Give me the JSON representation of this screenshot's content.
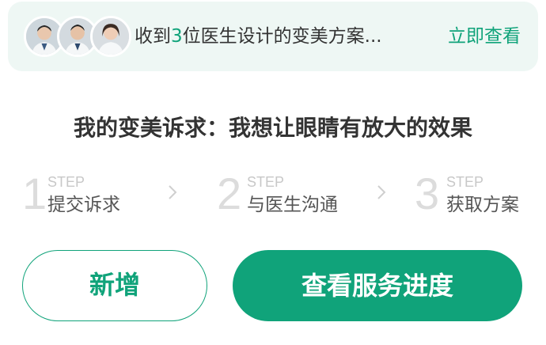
{
  "banner": {
    "text_prefix": "收到",
    "doctor_count": "3",
    "text_suffix": "位医生设计的变美方案...",
    "link_label": "立即查看",
    "avatars": [
      "doctor-avatar-1",
      "doctor-avatar-2",
      "doctor-avatar-3"
    ]
  },
  "request": {
    "title": "我的变美诉求：我想让眼睛有放大的效果"
  },
  "steps": [
    {
      "number": "1",
      "step_text": "STEP",
      "label": "提交诉求"
    },
    {
      "number": "2",
      "step_text": "STEP",
      "label": "与医生沟通"
    },
    {
      "number": "3",
      "step_text": "STEP",
      "label": "获取方案"
    }
  ],
  "actions": {
    "add_label": "新增",
    "progress_label": "查看服务进度"
  },
  "colors": {
    "accent": "#10a37a",
    "banner_bg": "#eef7f4",
    "step_number": "#dcdcdc"
  }
}
